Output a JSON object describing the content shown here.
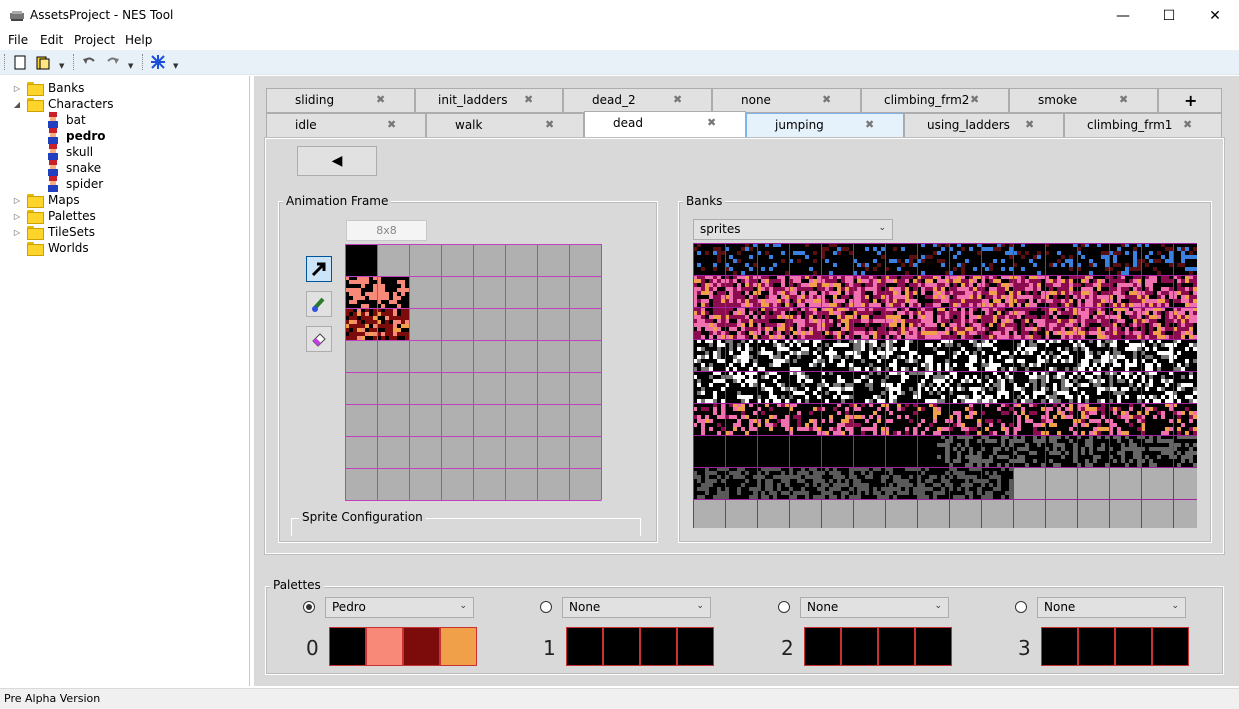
{
  "window": {
    "title": "AssetsProject - NES Tool",
    "minimize": "—",
    "maximize": "☐",
    "close": "✕"
  },
  "menu": {
    "file": "File",
    "edit": "Edit",
    "project": "Project",
    "help": "Help"
  },
  "toolbar": {
    "icons": [
      "new-file-icon",
      "open-folder-icon",
      "undo-icon",
      "redo-icon",
      "build-icon"
    ]
  },
  "tree": {
    "items": [
      {
        "label": "Banks",
        "type": "folder",
        "expander": "▷"
      },
      {
        "label": "Characters",
        "type": "folder",
        "expander": "◢"
      },
      {
        "label": "bat",
        "type": "character"
      },
      {
        "label": "pedro",
        "type": "character",
        "bold": true
      },
      {
        "label": "skull",
        "type": "character"
      },
      {
        "label": "snake",
        "type": "character"
      },
      {
        "label": "spider",
        "type": "character"
      },
      {
        "label": "Maps",
        "type": "folder",
        "expander": "▷"
      },
      {
        "label": "Palettes",
        "type": "folder",
        "expander": "▷"
      },
      {
        "label": "TileSets",
        "type": "folder",
        "expander": "▷"
      },
      {
        "label": "Worlds",
        "type": "folder",
        "expander": ""
      }
    ]
  },
  "tabs": {
    "row1": [
      "sliding",
      "init_ladders",
      "dead_2",
      "none",
      "climbing_frm2",
      "smoke"
    ],
    "row2": [
      "idle",
      "walk",
      "dead",
      "jumping",
      "using_ladders",
      "climbing_frm1"
    ],
    "add": "+",
    "close": "✖",
    "active": "dead"
  },
  "flip_button": "◀",
  "animation_frame": {
    "title": "Animation Frame",
    "size_label": "8x8",
    "tools": [
      "select-arrow-icon",
      "brush-icon",
      "eraser-icon"
    ],
    "sprite_config_title": "Sprite Configuration"
  },
  "banks": {
    "title": "Banks",
    "selected": "sprites"
  },
  "palettes": {
    "title": "Palettes",
    "entries": [
      {
        "index": "0",
        "name": "Pedro",
        "selected": true,
        "colors": [
          "#000000",
          "#f88878",
          "#7c0c0c",
          "#f0a048"
        ]
      },
      {
        "index": "1",
        "name": "None",
        "selected": false,
        "colors": [
          "#000000",
          "#000000",
          "#000000",
          "#000000"
        ]
      },
      {
        "index": "2",
        "name": "None",
        "selected": false,
        "colors": [
          "#000000",
          "#000000",
          "#000000",
          "#000000"
        ]
      },
      {
        "index": "3",
        "name": "None",
        "selected": false,
        "colors": [
          "#000000",
          "#000000",
          "#000000",
          "#000000"
        ]
      }
    ]
  },
  "status": {
    "text": "Pre Alpha Version"
  }
}
